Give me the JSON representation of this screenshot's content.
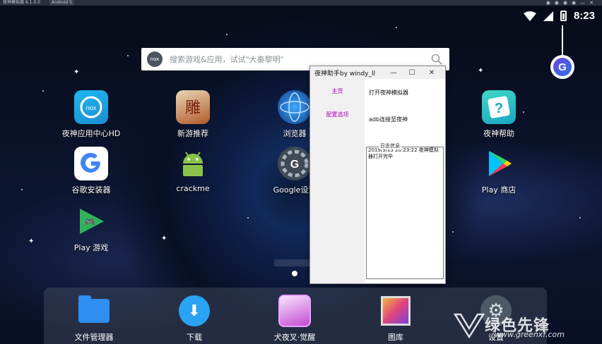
{
  "emulator": {
    "title": "夜神模拟器 6.1.0.0",
    "tag": "Android 5"
  },
  "status": {
    "time": "8:23"
  },
  "google_widget": {
    "letter": "G"
  },
  "search": {
    "logo": "nox",
    "placeholder": "搜索游戏&应用，试试\"大秦黎明\""
  },
  "apps": {
    "nox_center": "夜神应用中心HD",
    "new_games": "新游推荐",
    "browser": "浏览器",
    "nox_help": "夜神帮助",
    "google_installer": "谷歌安装器",
    "crackme": "crackme",
    "google_settings": "Google设置",
    "play_store": "Play 商店",
    "play_games": "Play 游戏"
  },
  "dock": {
    "file_manager": "文件管理器",
    "download": "下载",
    "inuyasha": "犬夜叉·觉醒",
    "gallery": "图库",
    "settings": "设置"
  },
  "watermark": {
    "name": "绿色先锋",
    "url": "www.greenxf.com"
  },
  "helper_window": {
    "title": "夜神助手by windy_ll",
    "nav": {
      "home": "主页",
      "config": "配置选项"
    },
    "buttons": {
      "open_emulator": "打开夜神模拟器",
      "adb_connect": "adb连接至夜神"
    },
    "log_label": "日志信息",
    "log_text": "2019/9/13 20:23:22 夜神模拟器打开完毕"
  },
  "colors": {
    "nav_link": "#b000c0",
    "accent_blue": "#2aa3f5"
  }
}
